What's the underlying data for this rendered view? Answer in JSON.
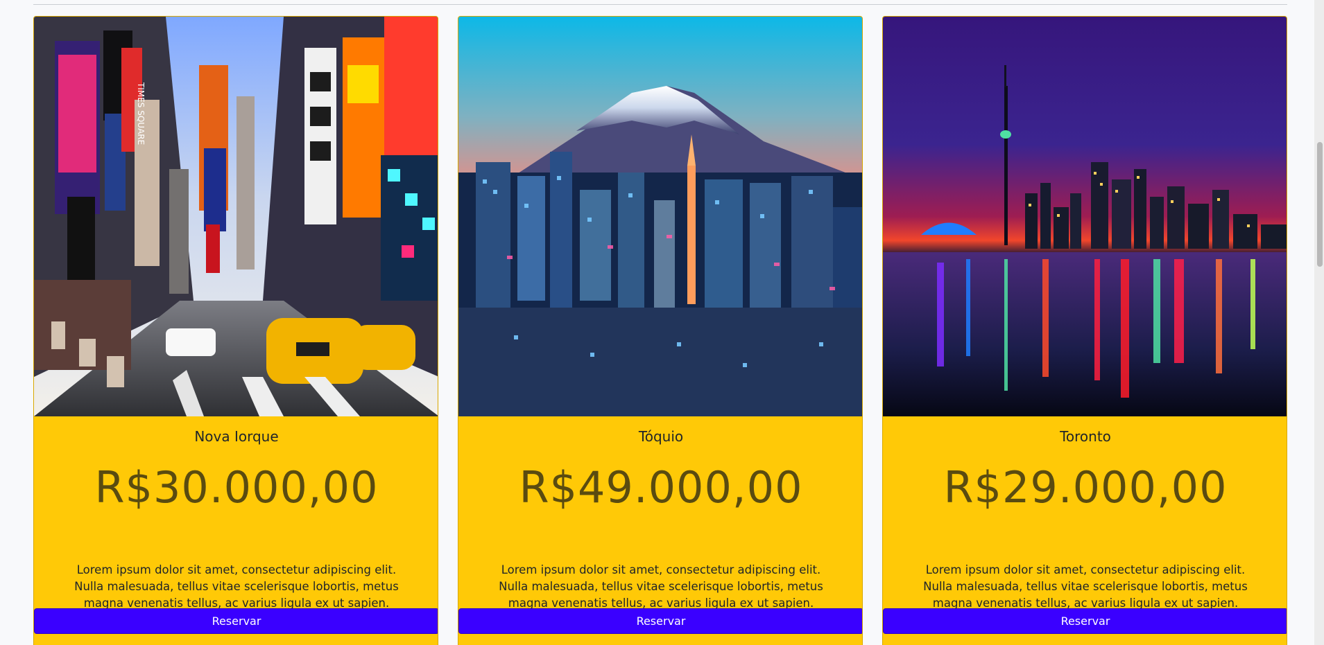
{
  "cards": [
    {
      "image_label": "Nova Iorque city image",
      "title": "Nova Iorque",
      "price": "R$30.000,00",
      "description": "Lorem ipsum dolor sit amet, consectetur adipiscing elit. Nulla malesuada, tellus vitae scelerisque lobortis, metus magna venenatis tellus, ac varius ligula ex ut sapien.",
      "button": "Reservar"
    },
    {
      "image_label": "Tóquio city image",
      "title": "Tóquio",
      "price": "R$49.000,00",
      "description": "Lorem ipsum dolor sit amet, consectetur adipiscing elit. Nulla malesuada, tellus vitae scelerisque lobortis, metus magna venenatis tellus, ac varius ligula ex ut sapien.",
      "button": "Reservar"
    },
    {
      "image_label": "Toronto city image",
      "title": "Toronto",
      "price": "R$29.000,00",
      "description": "Lorem ipsum dolor sit amet, consectetur adipiscing elit. Nulla malesuada, tellus vitae scelerisque lobortis, metus magna venenatis tellus, ac varius ligula ex ut sapien.",
      "button": "Reservar"
    }
  ],
  "colors": {
    "card_background": "#ffc907",
    "price_text": "#5a4b10",
    "button_background": "#3a00ff",
    "button_text": "#ffffff",
    "page_background": "#f8f9fb"
  },
  "icons": {
    "scrollbar": "vertical-scrollbar"
  }
}
